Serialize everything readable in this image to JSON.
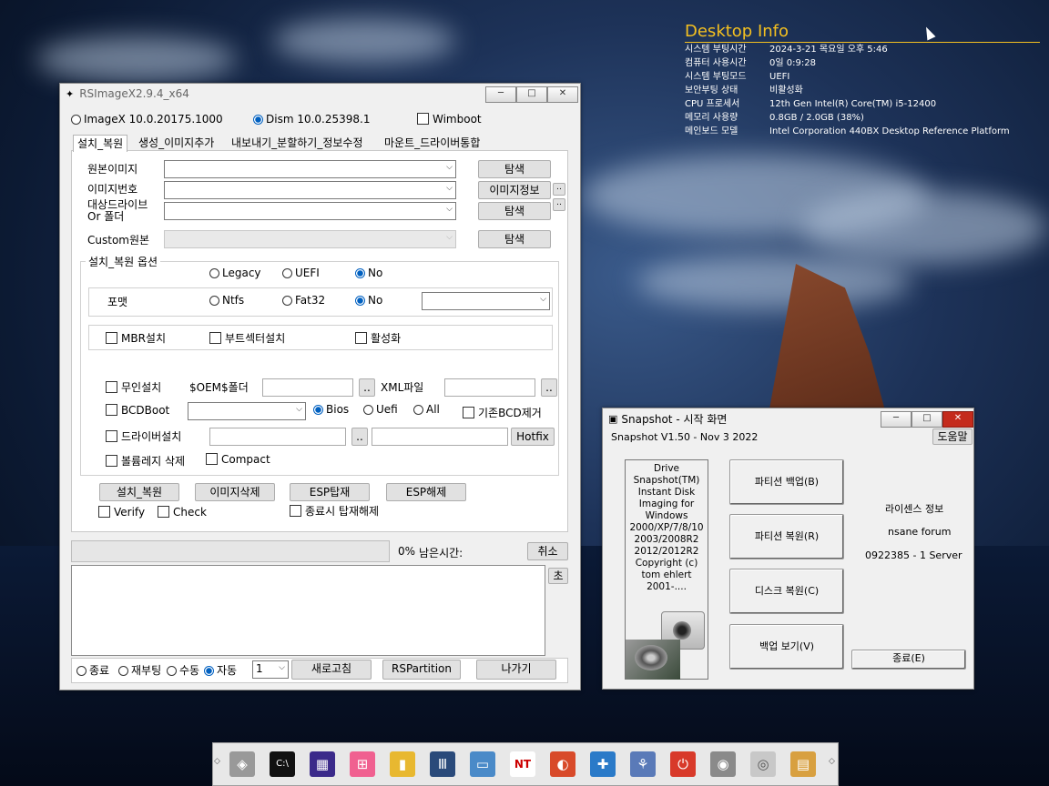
{
  "desktop_info": {
    "title": "Desktop Info",
    "rows": [
      {
        "k": "시스템 부팅시간",
        "v": "2024-3-21 목요일 오후 5:46"
      },
      {
        "k": "컴퓨터 사용시간",
        "v": "0일 0:9:28"
      },
      {
        "k": "시스템 부팅모드",
        "v": "UEFI"
      },
      {
        "k": "보안부팅 상태",
        "v": "비활성화"
      },
      {
        "k": "CPU 프로세서",
        "v": "12th Gen Intel(R) Core(TM) i5-12400"
      },
      {
        "k": "메모리 사용량",
        "v": "0.8GB / 2.0GB (38%)"
      },
      {
        "k": "메인보드 모델",
        "v": "Intel Corporation 440BX Desktop Reference Platform"
      }
    ]
  },
  "rsimagex": {
    "title": "RSImageX2.9.4_x64",
    "top_radios": [
      "ImageX 10.0.20175.1000",
      "Dism 10.0.25398.1"
    ],
    "wimboot": "Wimboot",
    "tabs": [
      "설치_복원",
      "생성_이미지추가",
      "내보내기_분할하기_정보수정",
      "마운트_드라이버통합"
    ],
    "source_image": "원본이미지",
    "image_number": "이미지번호",
    "target_drive": "대상드라이브",
    "or_folder": "Or 폴더",
    "custom_source": "Custom원본",
    "browse": "탐색",
    "image_info": "이미지정보",
    "dots": "..",
    "options_title": "설치_복원 옵션",
    "boot_radios": [
      "Legacy",
      "UEFI",
      "No"
    ],
    "format_label": "포맷",
    "format_radios": [
      "Ntfs",
      "Fat32",
      "No"
    ],
    "mbr": "MBR설치",
    "bootsector": "부트섹터설치",
    "activate": "활성화",
    "unattend": "무인설치",
    "oem_folder": "$OEM$폴더",
    "xml_file": "XML파일",
    "bcdboot": "BCDBoot",
    "bcd_radios": [
      "Bios",
      "Uefi",
      "All"
    ],
    "bcd_remove": "기존BCD제거",
    "driver_install": "드라이버설치",
    "hotfix": "Hotfix",
    "volume_delete": "볼륨레지 삭제",
    "compact": "Compact",
    "action_buttons": [
      "설치_복원",
      "이미지삭제",
      "ESP탑재",
      "ESP해제"
    ],
    "verify": "Verify",
    "check": "Check",
    "unmount_on_exit": "종료시 탑재해제",
    "progress_pct": "0%",
    "remaining": "남은시간:",
    "cancel": "취소",
    "seconds": "초",
    "bottom_radios": [
      "종료",
      "재부팅",
      "수동",
      "자동"
    ],
    "count_value": "1",
    "refresh": "새로고침",
    "rspartition": "RSPartition",
    "exit": "나가기"
  },
  "snapshot": {
    "title": "Snapshot - 시작 화면",
    "version": "Snapshot V1.50 - Nov  3 2022",
    "help": "도움말",
    "about_lines": [
      "Drive",
      "Snapshot(TM)",
      "Instant Disk",
      "Imaging for",
      "Windows",
      "2000/XP/7/8/10",
      "2003/2008R2",
      "2012/2012R2",
      "Copyright (c)",
      "tom ehlert",
      "2001-...."
    ],
    "buttons": [
      "파티션 백업(B)",
      "파티션 복원(R)",
      "디스크 복원(C)",
      "백업 보기(V)"
    ],
    "license_title": "라이센스 정보",
    "license_name": "nsane forum",
    "license_id": "0922385 - 1 Server",
    "exit": "종료(E)"
  },
  "taskbar": {
    "icons": [
      "drive-icon",
      "cmd-icon",
      "cpu-icon",
      "windows-icon",
      "folder-icon",
      "equalizer-icon",
      "monitor-icon",
      "nt-icon",
      "partition-icon",
      "puzzle-icon",
      "network-icon",
      "power-icon",
      "snapshot-icon",
      "disc-icon",
      "archive-icon",
      "file-icon"
    ]
  },
  "colors": {
    "desktop_title": "#f4c020",
    "accent_radio": "#0060c0",
    "close_red": "#c42b1c"
  }
}
